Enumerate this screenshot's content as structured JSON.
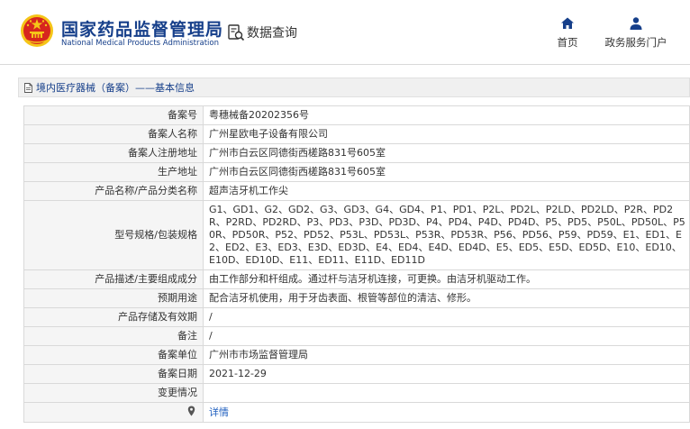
{
  "header": {
    "brand_cn": "国家药品监督管理局",
    "brand_en": "National Medical Products Administration",
    "search_label": "数据查询",
    "nav_home": "首页",
    "nav_service": "政务服务门户",
    "colors": {
      "brand": "#163f8a",
      "emblem_red": "#d7261e",
      "emblem_gold": "#f5c518"
    },
    "icons": {
      "emblem": "national-emblem-icon",
      "search": "document-search-icon",
      "home": "home-icon",
      "service": "user-icon"
    }
  },
  "breadcrumb": {
    "text": "境内医疗器械（备案）——基本信息",
    "icon": "document-icon"
  },
  "table": {
    "rows": [
      {
        "label": "备案号",
        "value": "粤穗械备20202356号"
      },
      {
        "label": "备案人名称",
        "value": "广州星欧电子设备有限公司"
      },
      {
        "label": "备案人注册地址",
        "value": "广州市白云区同德街西槎路831号605室"
      },
      {
        "label": "生产地址",
        "value": "广州市白云区同德街西槎路831号605室"
      },
      {
        "label": "产品名称/产品分类名称",
        "value": "超声洁牙机工作尖"
      },
      {
        "label": "型号规格/包装规格",
        "value": "G1、GD1、G2、GD2、G3、GD3、G4、GD4、P1、PD1、P2L、PD2L、P2LD、PD2LD、P2R、PD2R、P2RD、PD2RD、P3、PD3、P3D、PD3D、P4、PD4、P4D、PD4D、P5、PD5、P50L、PD50L、P50R、PD50R、P52、PD52、P53L、PD53L、P53R、PD53R、P56、PD56、P59、PD59、E1、ED1、E2、ED2、E3、ED3、E3D、ED3D、E4、ED4、E4D、ED4D、E5、ED5、E5D、ED5D、E10、ED10、E10D、ED10D、E11、ED11、E11D、ED11D"
      },
      {
        "label": "产品描述/主要组成成分",
        "value": "由工作部分和杆组成。通过杆与洁牙机连接，可更换。由洁牙机驱动工作。"
      },
      {
        "label": "预期用途",
        "value": "配合洁牙机使用，用于牙齿表面、根管等部位的清洁、修形。"
      },
      {
        "label": "产品存储及有效期",
        "value": "/"
      },
      {
        "label": "备注",
        "value": "/"
      },
      {
        "label": "备案单位",
        "value": "广州市市场监督管理局"
      },
      {
        "label": "备案日期",
        "value": "2021-12-29"
      },
      {
        "label": "变更情况",
        "value": ""
      }
    ],
    "detail_row": {
      "label": "",
      "link": "详情",
      "icon": "location-pin-icon"
    }
  }
}
